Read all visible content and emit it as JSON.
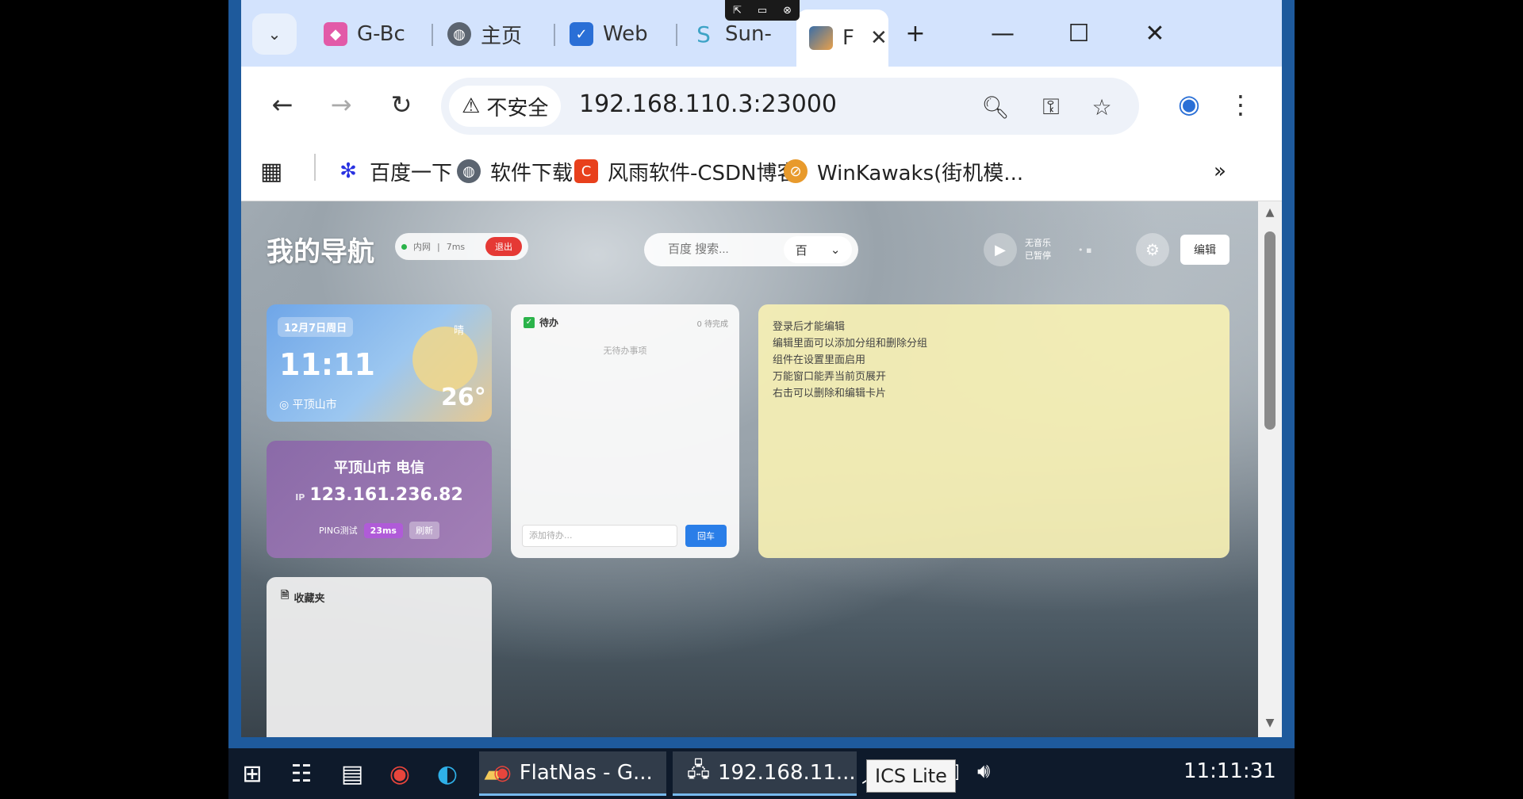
{
  "browser": {
    "tabs": [
      {
        "label": "G-Bc",
        "icon": "gbox-icon"
      },
      {
        "label": "主页",
        "icon": "globe-icon"
      },
      {
        "label": "Web",
        "icon": "web-icon"
      },
      {
        "label": "Sun-",
        "icon": "sun-icon"
      },
      {
        "label": "F",
        "icon": "flatnas-icon"
      }
    ],
    "new_tab": "+",
    "security_label": "不安全",
    "url": "192.168.110.3:23000",
    "bookmarks": [
      "百度一下",
      "软件下载",
      "风雨软件-CSDN博客",
      "WinKawaks(街机模..."
    ],
    "more_bookmarks": "»"
  },
  "page": {
    "title": "我的导航",
    "status": {
      "net": "内网",
      "latency": "7ms",
      "exit": "退出"
    },
    "search": {
      "placeholder": "百度 搜索...",
      "engine": "百"
    },
    "music": {
      "line1": "无音乐",
      "line2": "已暂停"
    },
    "edit_label": "编辑",
    "weather": {
      "date": "12月7日周日",
      "time": "11:11",
      "city": "平顶山市",
      "temp": "26°",
      "condition": "晴"
    },
    "todo": {
      "title": "待办",
      "count": "0 待完成",
      "empty": "无待办事项",
      "input_placeholder": "添加待办...",
      "add_label": "回车"
    },
    "notes": [
      "登录后才能编辑",
      "编辑里面可以添加分组和删除分组",
      "组件在设置里面启用",
      "万能窗口能弄当前页展开",
      "右击可以删除和编辑卡片"
    ],
    "ip": {
      "isp": "平顶山市 电信",
      "prefix": "IP",
      "address": "123.161.236.82",
      "ping_label": "PING测试",
      "ping_value": "23ms",
      "refresh": "刷新"
    },
    "favorites": {
      "title": "收藏夹"
    }
  },
  "taskbar": {
    "apps": [
      {
        "label": "FlatNas - G...",
        "icon": "chrome-icon"
      },
      {
        "label": "192.168.11...",
        "icon": "remote-desktop-icon"
      }
    ],
    "tooltip": "ICS Lite",
    "clock": "11:11:31"
  },
  "colors": {
    "accent": "#2a7ee8",
    "danger": "#e53935",
    "taskbar": "#0e1a2b"
  }
}
